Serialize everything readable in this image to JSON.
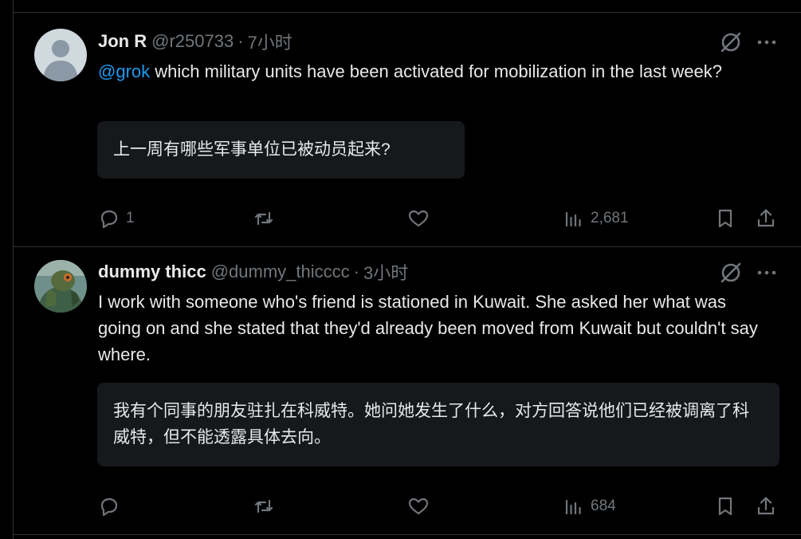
{
  "tweets": [
    {
      "name": "Jon R",
      "handle": "@r250733",
      "dot": "·",
      "time": "7小时",
      "mention": "@grok",
      "text": " which military units have been activated for mobilization in the last week?",
      "translation": "上一周有哪些军事单位已被动员起来?",
      "replies": "1",
      "views": "2,681"
    },
    {
      "name": "dummy thicc",
      "handle": "@dummy_thicccc",
      "dot": "·",
      "time": "3小时",
      "text": "I work with someone who's friend is stationed in Kuwait. She asked her what was going on and she stated that they'd already been moved from Kuwait but couldn't say where.",
      "translation": "我有个同事的朋友驻扎在科威特。她问她发生了什么，对方回答说他们已经被调离了科威特，但不能透露具体去向。",
      "views": "684"
    }
  ],
  "colors": {
    "background": "#000000",
    "text": "#e7e9ea",
    "muted": "#71767b",
    "link": "#1d9bf0",
    "border": "#2f3336",
    "translation_bg": "#16181c"
  }
}
